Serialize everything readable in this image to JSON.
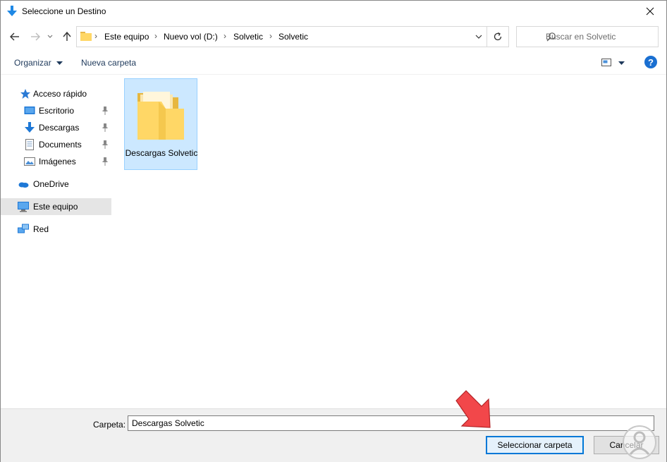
{
  "window": {
    "title": "Seleccione un Destino"
  },
  "nav": {
    "breadcrumbs": [
      "Este equipo",
      "Nuevo vol (D:)",
      "Solvetic",
      "Solvetic"
    ],
    "search_placeholder": "Buscar en Solvetic"
  },
  "toolbar": {
    "organize_label": "Organizar",
    "new_folder_label": "Nueva carpeta",
    "help_label": "?"
  },
  "sidebar": {
    "items": [
      {
        "label": "Acceso rápido",
        "icon": "star-icon"
      },
      {
        "label": "Escritorio",
        "icon": "desktop-icon",
        "pinned": true
      },
      {
        "label": "Descargas",
        "icon": "download-icon",
        "pinned": true
      },
      {
        "label": "Documents",
        "icon": "document-icon",
        "pinned": true
      },
      {
        "label": "Imágenes",
        "icon": "image-icon",
        "pinned": true
      },
      {
        "label": "OneDrive",
        "icon": "cloud-icon"
      },
      {
        "label": "Este equipo",
        "icon": "computer-icon",
        "selected": true
      },
      {
        "label": "Red",
        "icon": "network-icon"
      }
    ]
  },
  "content": {
    "folders": [
      {
        "label": "Descargas Solvetic",
        "selected": true
      }
    ]
  },
  "footer": {
    "folder_caption": "Carpeta:",
    "folder_value": "Descargas Solvetic",
    "select_button": "Seleccionar carpeta",
    "cancel_button": "Cancelar"
  },
  "colors": {
    "accent": "#0078d7",
    "selection": "#cce8ff",
    "folder_yellow": "#ffd766",
    "arrow_red": "#f2474a"
  }
}
